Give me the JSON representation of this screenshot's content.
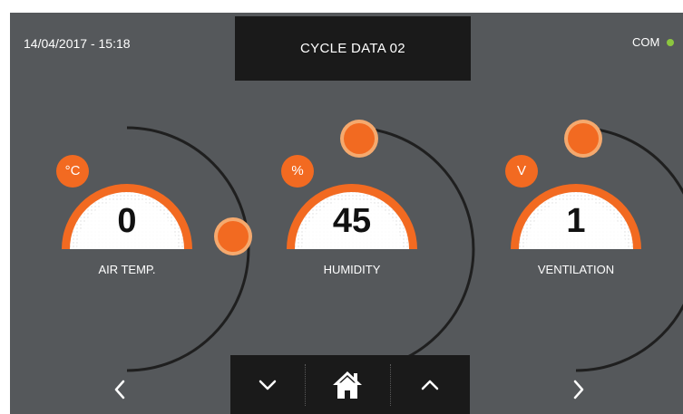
{
  "header": {
    "datetime": "14/04/2017 - 15:18",
    "title": "CYCLE DATA 02",
    "com_label": "COM",
    "com_status_color": "#8cc63f"
  },
  "gauges": [
    {
      "unit": "°C",
      "value": "0",
      "label": "AIR TEMP.",
      "level": 0.5
    },
    {
      "unit": "%",
      "value": "45",
      "label": "HUMIDITY",
      "level": 0.9
    },
    {
      "unit": "V",
      "value": "1",
      "label": "VENTILATION",
      "level": 0.9
    }
  ],
  "nav": {
    "prev_icon": "chevron-left-icon",
    "next_icon": "chevron-right-icon",
    "down_icon": "chevron-down-icon",
    "home_icon": "home-icon",
    "up_icon": "chevron-up-icon"
  },
  "colors": {
    "background": "#55585b",
    "accent": "#f26a21",
    "panel": "#1a1a1a",
    "text": "#ffffff"
  }
}
